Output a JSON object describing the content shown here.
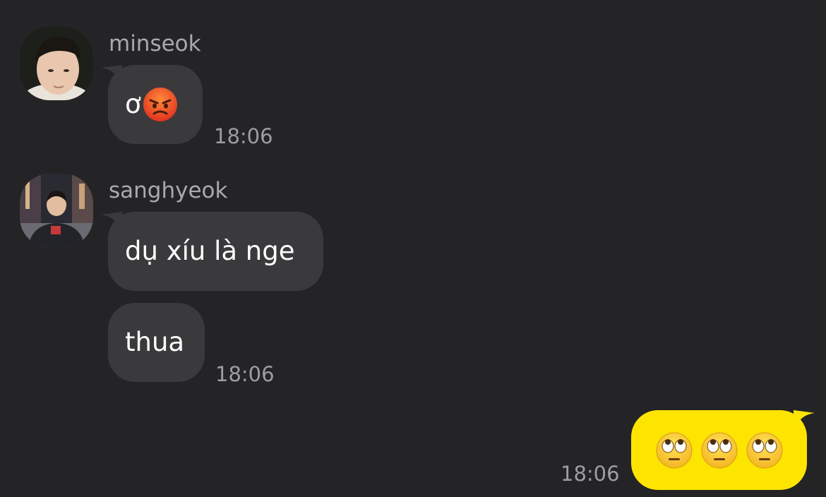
{
  "messages": [
    {
      "sender": "minseok",
      "avatar_icon": "minseok-avatar",
      "text": "ơ",
      "emoji_icons": [
        "angry-face-emoji"
      ],
      "time": "18:06"
    },
    {
      "sender": "sanghyeok",
      "avatar_icon": "sanghyeok-avatar",
      "texts": [
        "dụ xíu là nge",
        "thua"
      ],
      "time": "18:06"
    }
  ],
  "my_message": {
    "emoji_icons": [
      "rolling-eyes-emoji",
      "rolling-eyes-emoji",
      "rolling-eyes-emoji"
    ],
    "time": "18:06"
  },
  "colors": {
    "background": "#242427",
    "incoming_bubble": "#3a3a3d",
    "outgoing_bubble": "#fee500",
    "meta_text": "#a9a9ae"
  }
}
